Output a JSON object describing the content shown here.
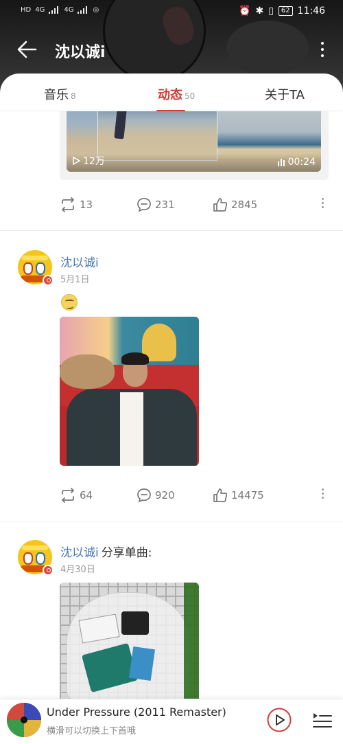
{
  "status_bar": {
    "left_labels": [
      "HD",
      "4G",
      "4G"
    ],
    "battery": "62",
    "time": "11:46"
  },
  "header": {
    "title": "沈以诚i"
  },
  "tabs": [
    {
      "label": "音乐",
      "count": "8"
    },
    {
      "label": "动态",
      "count": "50",
      "active": true
    },
    {
      "label": "关于TA",
      "count": ""
    }
  ],
  "posts": [
    {
      "video": {
        "plays": "12万",
        "duration": "00:24"
      },
      "actions": {
        "forward": "13",
        "comment": "231",
        "like": "2845"
      }
    },
    {
      "author": "沈以诚i",
      "date": "5月1日",
      "emoji": "dizzy-face-emoji",
      "actions": {
        "forward": "64",
        "comment": "920",
        "like": "14475"
      }
    },
    {
      "author": "沈以诚i",
      "share_text": "分享单曲:",
      "date": "4月30日"
    }
  ],
  "player": {
    "song_title": "Under Pressure (2011 Remaster)",
    "hint": "横滑可以切换上下首哦"
  },
  "colors": {
    "accent": "#d33a31",
    "username": "#4a78b0"
  }
}
